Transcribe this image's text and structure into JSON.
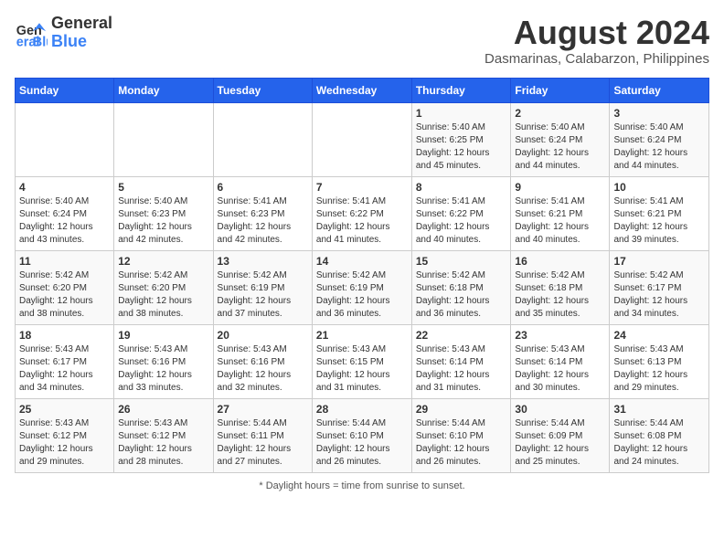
{
  "header": {
    "logo_general": "General",
    "logo_blue": "Blue",
    "main_title": "August 2024",
    "subtitle": "Dasmarinas, Calabarzon, Philippines"
  },
  "days_of_week": [
    "Sunday",
    "Monday",
    "Tuesday",
    "Wednesday",
    "Thursday",
    "Friday",
    "Saturday"
  ],
  "footer": {
    "note": "Daylight hours"
  },
  "weeks": [
    [
      {
        "date": "",
        "sunrise": "",
        "sunset": "",
        "daylight": ""
      },
      {
        "date": "",
        "sunrise": "",
        "sunset": "",
        "daylight": ""
      },
      {
        "date": "",
        "sunrise": "",
        "sunset": "",
        "daylight": ""
      },
      {
        "date": "",
        "sunrise": "",
        "sunset": "",
        "daylight": ""
      },
      {
        "date": "1",
        "sunrise": "Sunrise: 5:40 AM",
        "sunset": "Sunset: 6:25 PM",
        "daylight": "Daylight: 12 hours and 45 minutes."
      },
      {
        "date": "2",
        "sunrise": "Sunrise: 5:40 AM",
        "sunset": "Sunset: 6:24 PM",
        "daylight": "Daylight: 12 hours and 44 minutes."
      },
      {
        "date": "3",
        "sunrise": "Sunrise: 5:40 AM",
        "sunset": "Sunset: 6:24 PM",
        "daylight": "Daylight: 12 hours and 44 minutes."
      }
    ],
    [
      {
        "date": "4",
        "sunrise": "Sunrise: 5:40 AM",
        "sunset": "Sunset: 6:24 PM",
        "daylight": "Daylight: 12 hours and 43 minutes."
      },
      {
        "date": "5",
        "sunrise": "Sunrise: 5:40 AM",
        "sunset": "Sunset: 6:23 PM",
        "daylight": "Daylight: 12 hours and 42 minutes."
      },
      {
        "date": "6",
        "sunrise": "Sunrise: 5:41 AM",
        "sunset": "Sunset: 6:23 PM",
        "daylight": "Daylight: 12 hours and 42 minutes."
      },
      {
        "date": "7",
        "sunrise": "Sunrise: 5:41 AM",
        "sunset": "Sunset: 6:22 PM",
        "daylight": "Daylight: 12 hours and 41 minutes."
      },
      {
        "date": "8",
        "sunrise": "Sunrise: 5:41 AM",
        "sunset": "Sunset: 6:22 PM",
        "daylight": "Daylight: 12 hours and 40 minutes."
      },
      {
        "date": "9",
        "sunrise": "Sunrise: 5:41 AM",
        "sunset": "Sunset: 6:21 PM",
        "daylight": "Daylight: 12 hours and 40 minutes."
      },
      {
        "date": "10",
        "sunrise": "Sunrise: 5:41 AM",
        "sunset": "Sunset: 6:21 PM",
        "daylight": "Daylight: 12 hours and 39 minutes."
      }
    ],
    [
      {
        "date": "11",
        "sunrise": "Sunrise: 5:42 AM",
        "sunset": "Sunset: 6:20 PM",
        "daylight": "Daylight: 12 hours and 38 minutes."
      },
      {
        "date": "12",
        "sunrise": "Sunrise: 5:42 AM",
        "sunset": "Sunset: 6:20 PM",
        "daylight": "Daylight: 12 hours and 38 minutes."
      },
      {
        "date": "13",
        "sunrise": "Sunrise: 5:42 AM",
        "sunset": "Sunset: 6:19 PM",
        "daylight": "Daylight: 12 hours and 37 minutes."
      },
      {
        "date": "14",
        "sunrise": "Sunrise: 5:42 AM",
        "sunset": "Sunset: 6:19 PM",
        "daylight": "Daylight: 12 hours and 36 minutes."
      },
      {
        "date": "15",
        "sunrise": "Sunrise: 5:42 AM",
        "sunset": "Sunset: 6:18 PM",
        "daylight": "Daylight: 12 hours and 36 minutes."
      },
      {
        "date": "16",
        "sunrise": "Sunrise: 5:42 AM",
        "sunset": "Sunset: 6:18 PM",
        "daylight": "Daylight: 12 hours and 35 minutes."
      },
      {
        "date": "17",
        "sunrise": "Sunrise: 5:42 AM",
        "sunset": "Sunset: 6:17 PM",
        "daylight": "Daylight: 12 hours and 34 minutes."
      }
    ],
    [
      {
        "date": "18",
        "sunrise": "Sunrise: 5:43 AM",
        "sunset": "Sunset: 6:17 PM",
        "daylight": "Daylight: 12 hours and 34 minutes."
      },
      {
        "date": "19",
        "sunrise": "Sunrise: 5:43 AM",
        "sunset": "Sunset: 6:16 PM",
        "daylight": "Daylight: 12 hours and 33 minutes."
      },
      {
        "date": "20",
        "sunrise": "Sunrise: 5:43 AM",
        "sunset": "Sunset: 6:16 PM",
        "daylight": "Daylight: 12 hours and 32 minutes."
      },
      {
        "date": "21",
        "sunrise": "Sunrise: 5:43 AM",
        "sunset": "Sunset: 6:15 PM",
        "daylight": "Daylight: 12 hours and 31 minutes."
      },
      {
        "date": "22",
        "sunrise": "Sunrise: 5:43 AM",
        "sunset": "Sunset: 6:14 PM",
        "daylight": "Daylight: 12 hours and 31 minutes."
      },
      {
        "date": "23",
        "sunrise": "Sunrise: 5:43 AM",
        "sunset": "Sunset: 6:14 PM",
        "daylight": "Daylight: 12 hours and 30 minutes."
      },
      {
        "date": "24",
        "sunrise": "Sunrise: 5:43 AM",
        "sunset": "Sunset: 6:13 PM",
        "daylight": "Daylight: 12 hours and 29 minutes."
      }
    ],
    [
      {
        "date": "25",
        "sunrise": "Sunrise: 5:43 AM",
        "sunset": "Sunset: 6:12 PM",
        "daylight": "Daylight: 12 hours and 29 minutes."
      },
      {
        "date": "26",
        "sunrise": "Sunrise: 5:43 AM",
        "sunset": "Sunset: 6:12 PM",
        "daylight": "Daylight: 12 hours and 28 minutes."
      },
      {
        "date": "27",
        "sunrise": "Sunrise: 5:44 AM",
        "sunset": "Sunset: 6:11 PM",
        "daylight": "Daylight: 12 hours and 27 minutes."
      },
      {
        "date": "28",
        "sunrise": "Sunrise: 5:44 AM",
        "sunset": "Sunset: 6:10 PM",
        "daylight": "Daylight: 12 hours and 26 minutes."
      },
      {
        "date": "29",
        "sunrise": "Sunrise: 5:44 AM",
        "sunset": "Sunset: 6:10 PM",
        "daylight": "Daylight: 12 hours and 26 minutes."
      },
      {
        "date": "30",
        "sunrise": "Sunrise: 5:44 AM",
        "sunset": "Sunset: 6:09 PM",
        "daylight": "Daylight: 12 hours and 25 minutes."
      },
      {
        "date": "31",
        "sunrise": "Sunrise: 5:44 AM",
        "sunset": "Sunset: 6:08 PM",
        "daylight": "Daylight: 12 hours and 24 minutes."
      }
    ]
  ]
}
